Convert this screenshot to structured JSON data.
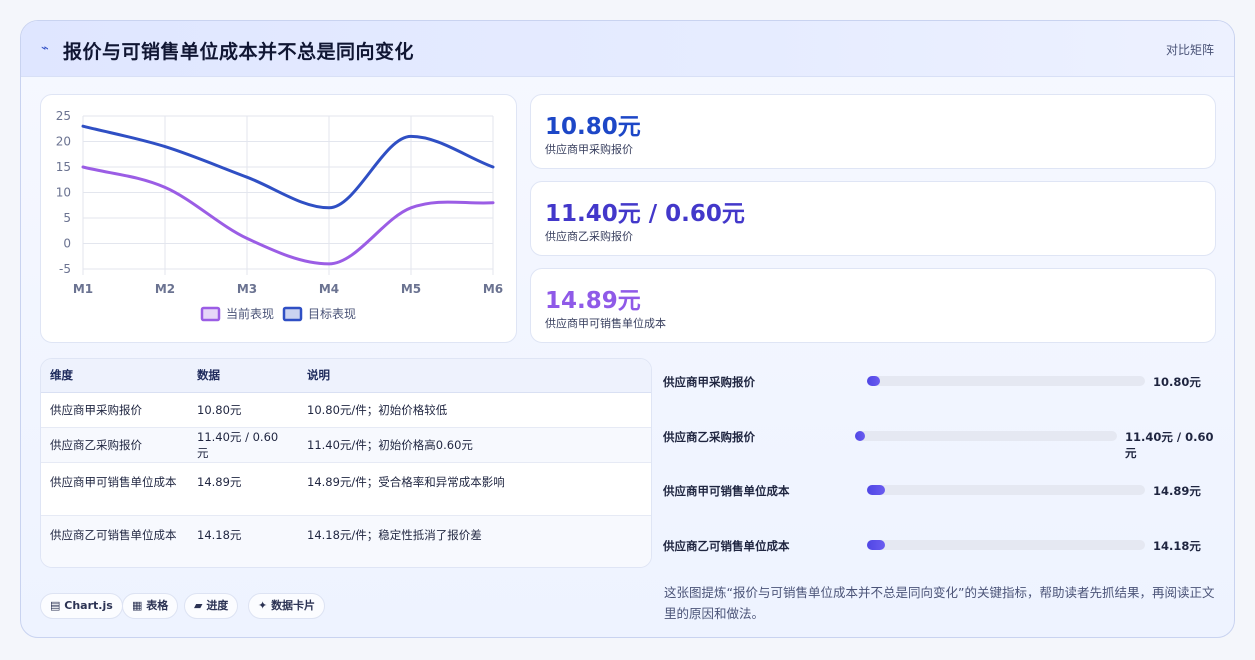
{
  "header": {
    "title_icon": "trend-icon",
    "title": "报价与可销售单位成本并不总是同向变化",
    "tag": "对比矩阵"
  },
  "chart_data": {
    "type": "line",
    "categories": [
      "M1",
      "M2",
      "M3",
      "M4",
      "M5",
      "M6"
    ],
    "series": [
      {
        "name": "当前表现",
        "values": [
          15,
          11,
          1,
          -4,
          7,
          8
        ],
        "color": "#9b5de5"
      },
      {
        "name": "目标表现",
        "values": [
          23,
          19,
          13,
          7,
          21,
          15
        ],
        "color": "#2f4fc4"
      }
    ],
    "ylim": [
      -5,
      25
    ],
    "yticks": [
      "-5",
      "0",
      "5",
      "10",
      "15",
      "20",
      "25"
    ],
    "grid": true,
    "legend": "bottom",
    "smooth": true
  },
  "kpis": [
    {
      "value": "10.80元",
      "label": "供应商甲采购报价",
      "color": "#1d47c7"
    },
    {
      "value": "11.40元 / 0.60元",
      "label": "供应商乙采购报价",
      "color": "#4338ca"
    },
    {
      "value": "14.89元",
      "label": "供应商甲可销售单位成本",
      "color": "#8f5ae8"
    }
  ],
  "table": {
    "headers": [
      "维度",
      "数据",
      "说明"
    ],
    "rows": [
      [
        "供应商甲采购报价",
        "10.80元",
        "10.80元/件；初始价格较低"
      ],
      [
        "供应商乙采购报价",
        "11.40元 / 0.60元",
        "11.40元/件；初始价格高0.60元"
      ],
      [
        "供应商甲可销售单位成本",
        "14.89元",
        "14.89元/件；受合格率和异常成本影响"
      ],
      [
        "供应商乙可销售单位成本",
        "14.18元",
        "14.18元/件；稳定性抵消了报价差"
      ]
    ]
  },
  "progress": [
    {
      "label": "供应商甲采购报价",
      "value": "10.80元",
      "level": 0.045
    },
    {
      "label": "供应商乙采购报价",
      "value": "11.40元 / 0.60元",
      "level": 0.04
    },
    {
      "label": "供应商甲可销售单位成本",
      "value": "14.89元",
      "level": 0.065
    },
    {
      "label": "供应商乙可销售单位成本",
      "value": "14.18元",
      "level": 0.065
    }
  ],
  "chips": [
    {
      "icon": "chart-icon",
      "glyph": "▤",
      "label": "Chart.js"
    },
    {
      "icon": "table-icon",
      "glyph": "▦",
      "label": "表格"
    },
    {
      "icon": "progress-icon",
      "glyph": "▰",
      "label": "进度"
    },
    {
      "icon": "card-icon",
      "glyph": "✦",
      "label": "数据卡片"
    }
  ],
  "note": "这张图提炼“报价与可销售单位成本并不总是同向变化”的关键指标，帮助读者先抓结果，再阅读正文里的原因和做法。"
}
